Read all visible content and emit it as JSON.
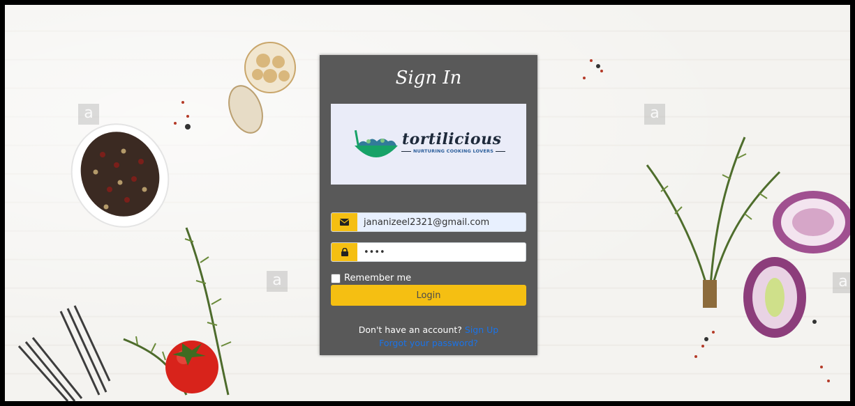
{
  "background": {
    "watermark_letter": "a"
  },
  "signin": {
    "title": "Sign In",
    "logo": {
      "brand": "tortilicious",
      "tagline": "NURTURING COOKING LOVERS",
      "icon": "salad-bowl-icon"
    },
    "email": {
      "icon": "envelope-icon",
      "value": "jananizeel2321@gmail.com"
    },
    "password": {
      "icon": "lock-icon",
      "value": "••••"
    },
    "remember_label": "Remember me",
    "login_label": "Login",
    "no_account_text": "Don't have an account?",
    "signup_link": "Sign Up",
    "forgot_link": "Forgot your password?"
  },
  "colors": {
    "card_bg": "#595959",
    "accent": "#f5bf12",
    "link": "#1a73e8",
    "logo_bg": "#eaecf8"
  }
}
